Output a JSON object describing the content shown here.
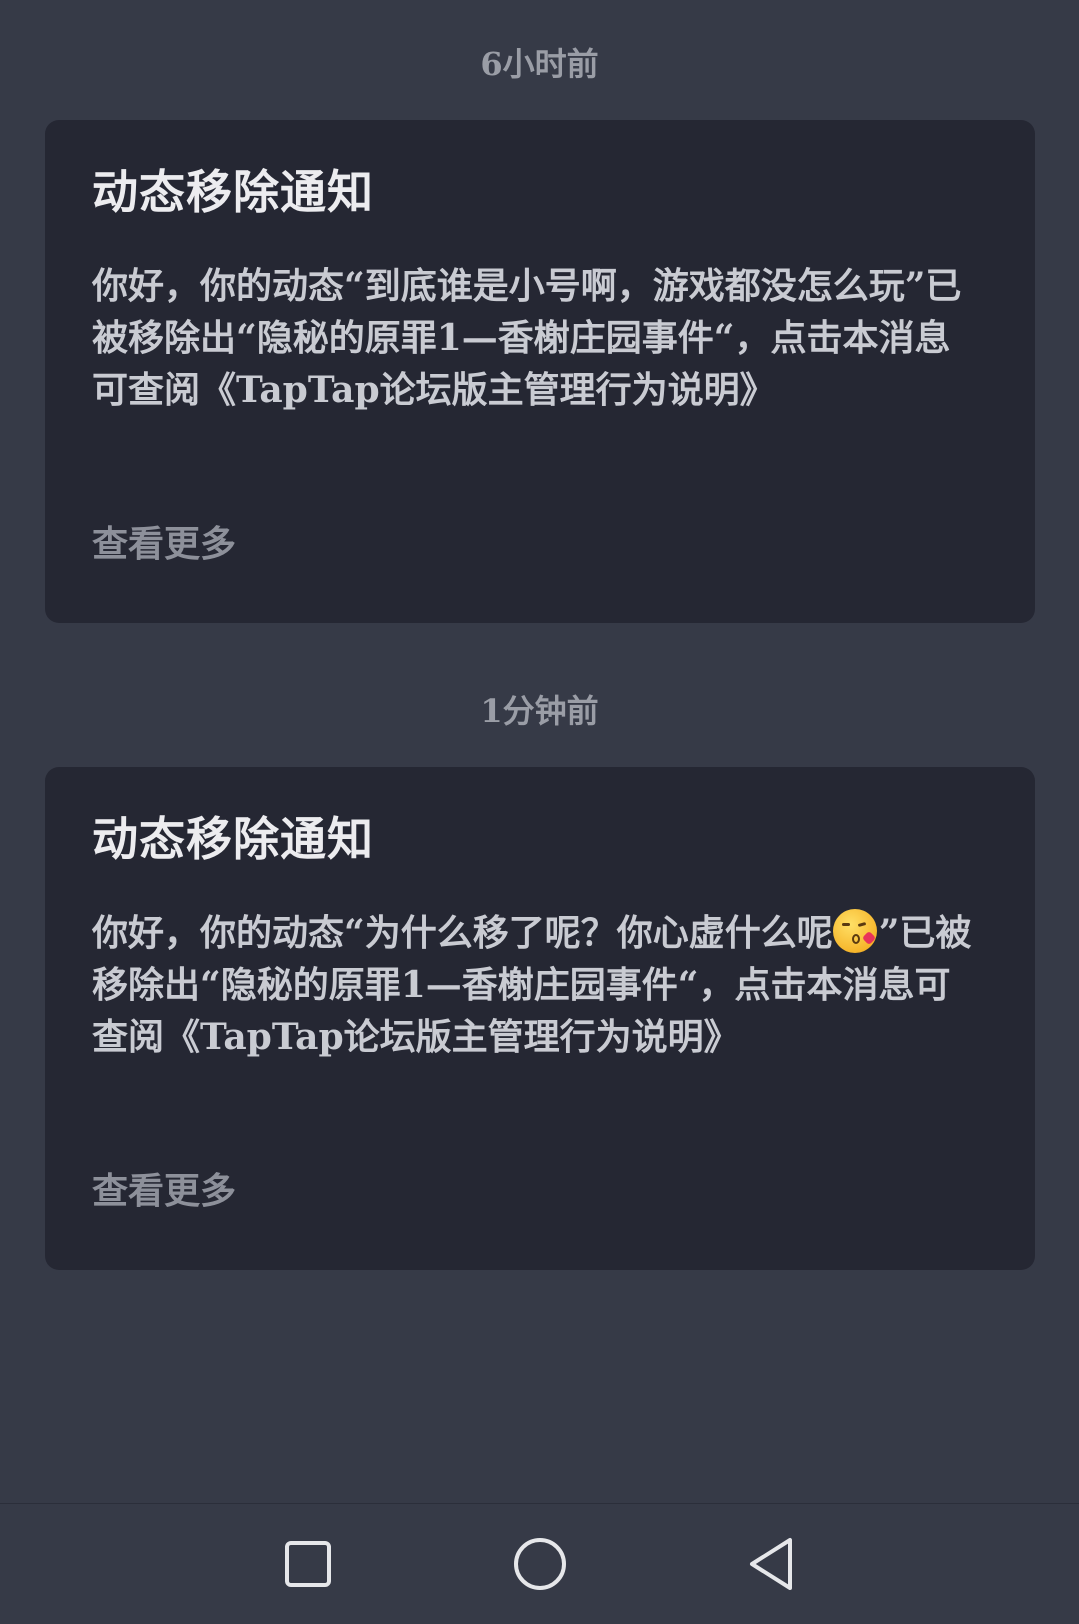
{
  "notifications": [
    {
      "time": "6小时前",
      "title": "动态移除通知",
      "body": "你好，你的动态“到底谁是小号啊，游戏都没怎么玩”已被移除出“隐秘的原罪1—香榭庄园事件“，点击本消息可查阅《TapTap论坛版主管理行为说明》",
      "more_label": "查看更多"
    },
    {
      "time": "1分钟前",
      "title": "动态移除通知",
      "body_before_emoji": "你好，你的动态“为什么移了呢？你心虚什么呢",
      "emoji_icon": "kissing-face-with-heart-emoji",
      "body_after_emoji": "”已被移除出“隐秘的原罪1—香榭庄园事件“，点击本消息可查阅《TapTap论坛版主管理行为说明》",
      "more_label": "查看更多"
    }
  ],
  "nav_bar": {
    "recent_icon": "square-recent-apps-icon",
    "home_icon": "circle-home-icon",
    "back_icon": "triangle-back-icon"
  },
  "colors": {
    "background": "#363a47",
    "card": "#252733",
    "title": "#ececef",
    "body": "#c9cbd2",
    "muted": "#8d909a"
  }
}
